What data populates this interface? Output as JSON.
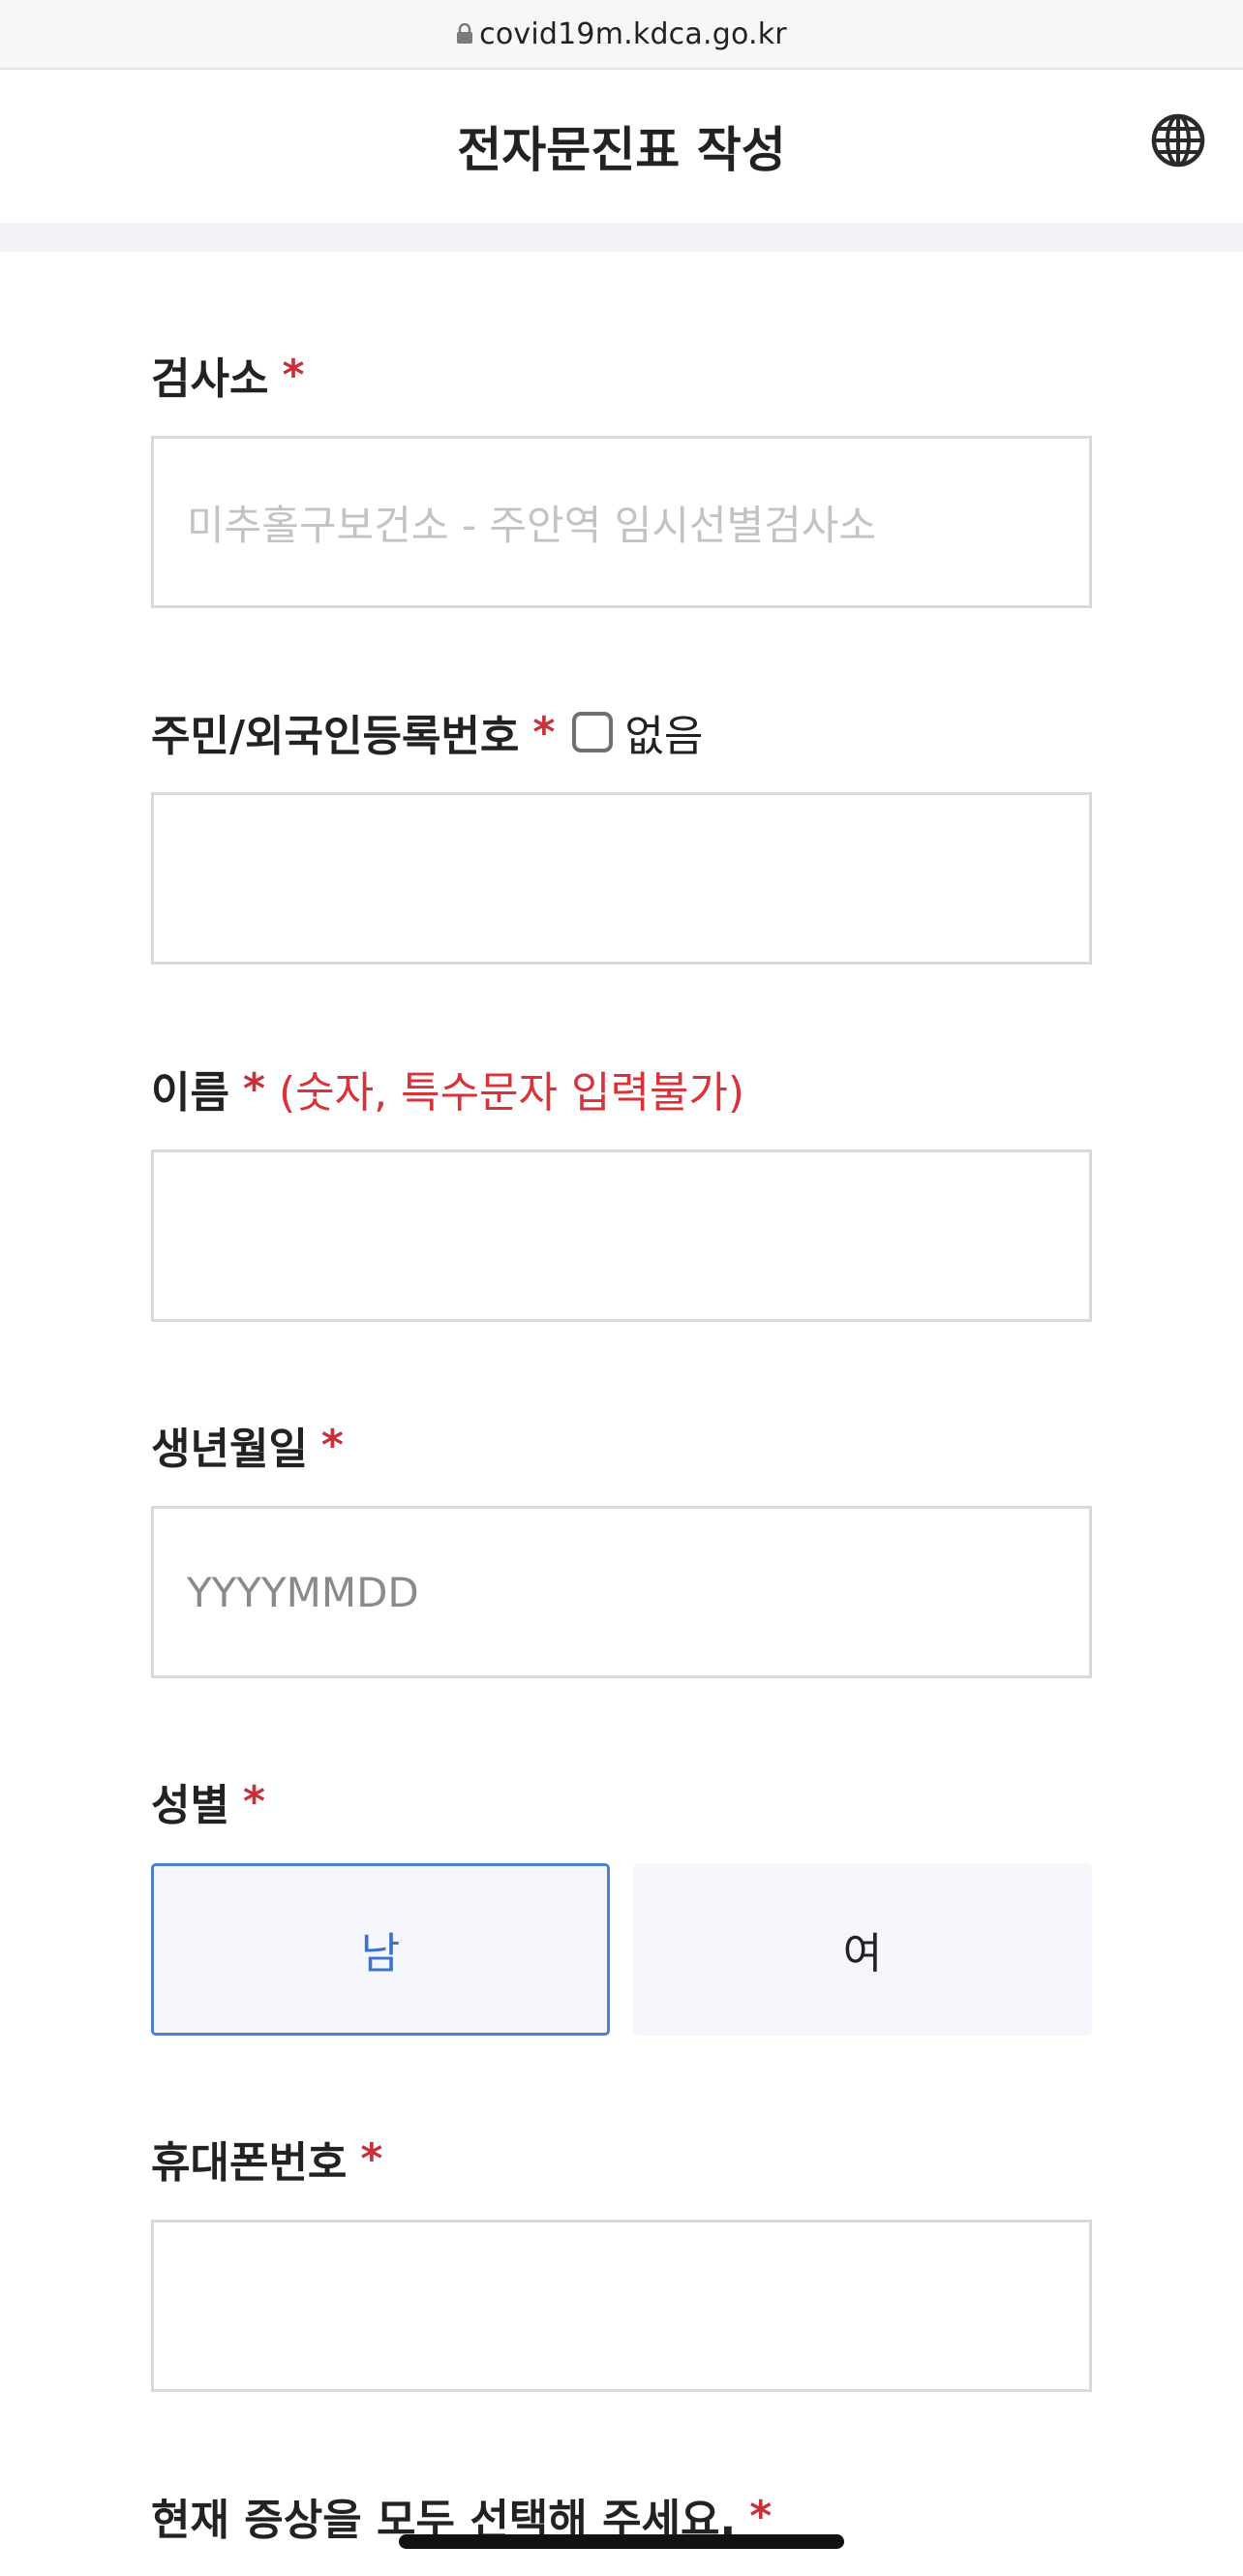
{
  "browser": {
    "url": "covid19m.kdca.go.kr"
  },
  "header": {
    "title": "전자문진표 작성",
    "language_icon": "globe-icon"
  },
  "form": {
    "required_mark": "*",
    "test_site": {
      "label": "검사소",
      "placeholder": "미추홀구보건소 - 주안역 임시선별검사소"
    },
    "resident_number": {
      "label": "주민/외국인등록번호",
      "none_checkbox_label": "없음",
      "value": ""
    },
    "name": {
      "label": "이름",
      "note": "(숫자, 특수문자 입력불가)",
      "value": ""
    },
    "birthdate": {
      "label": "생년월일",
      "placeholder": "YYYYMMDD"
    },
    "gender": {
      "label": "성별",
      "options": [
        "남",
        "여"
      ],
      "selected": "남"
    },
    "phone": {
      "label": "휴대폰번호",
      "value": ""
    },
    "symptoms": {
      "label": "현재 증상을 모두 선택해 주세요."
    }
  },
  "colors": {
    "required": "#c9303a",
    "note": "#d8323a",
    "selected_border": "#4a7fd4",
    "selected_text": "#3a74cf",
    "option_background": "#f4f6fb"
  }
}
